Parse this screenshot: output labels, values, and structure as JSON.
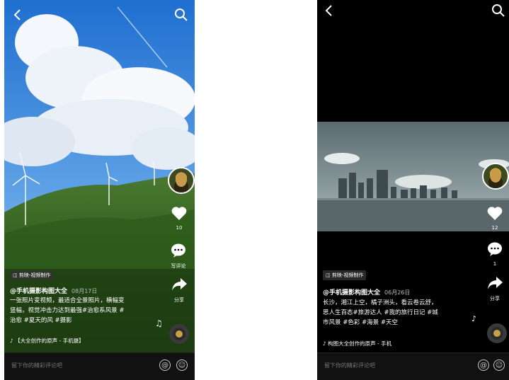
{
  "left": {
    "brand": "剪映-视频制作",
    "author": "@手机摄影构图大全",
    "date": "08月17日",
    "desc_lines": [
      "一张照片变视频，最适合全景照片，横幅变",
      "竖幅，视觉冲击力达到最强#治愈系风景 #",
      "治愈 #夏天的风 #摄影"
    ],
    "music": "♪ 【大全创作的原声 - 手机摄】",
    "like_count": "10",
    "comment_label": "写评论",
    "share_label": "分享",
    "comment_placeholder": "留下你的精彩评论吧"
  },
  "right": {
    "brand": "剪映-视频制作",
    "author": "@手机摄影构图大全",
    "date": "06月26日",
    "desc_lines": [
      "长沙，湘江上空，橘子洲头，看云卷云舒，",
      "思人生百态#旅游达人 #我的旅行日记 #城",
      "市风景 #色彩 #海景 #天空"
    ],
    "music": "♪ 构图大全创作的原声 - 手机",
    "like_count": "12",
    "comment_count": "1",
    "share_label": "分享",
    "comment_placeholder": "留下你的精彩评论吧"
  },
  "icons": {
    "back": "chevron-left-icon",
    "search": "search-icon",
    "like": "heart-icon",
    "comment": "comment-icon",
    "share": "share-arrow-icon",
    "at": "at-icon",
    "emoji": "emoji-icon"
  }
}
